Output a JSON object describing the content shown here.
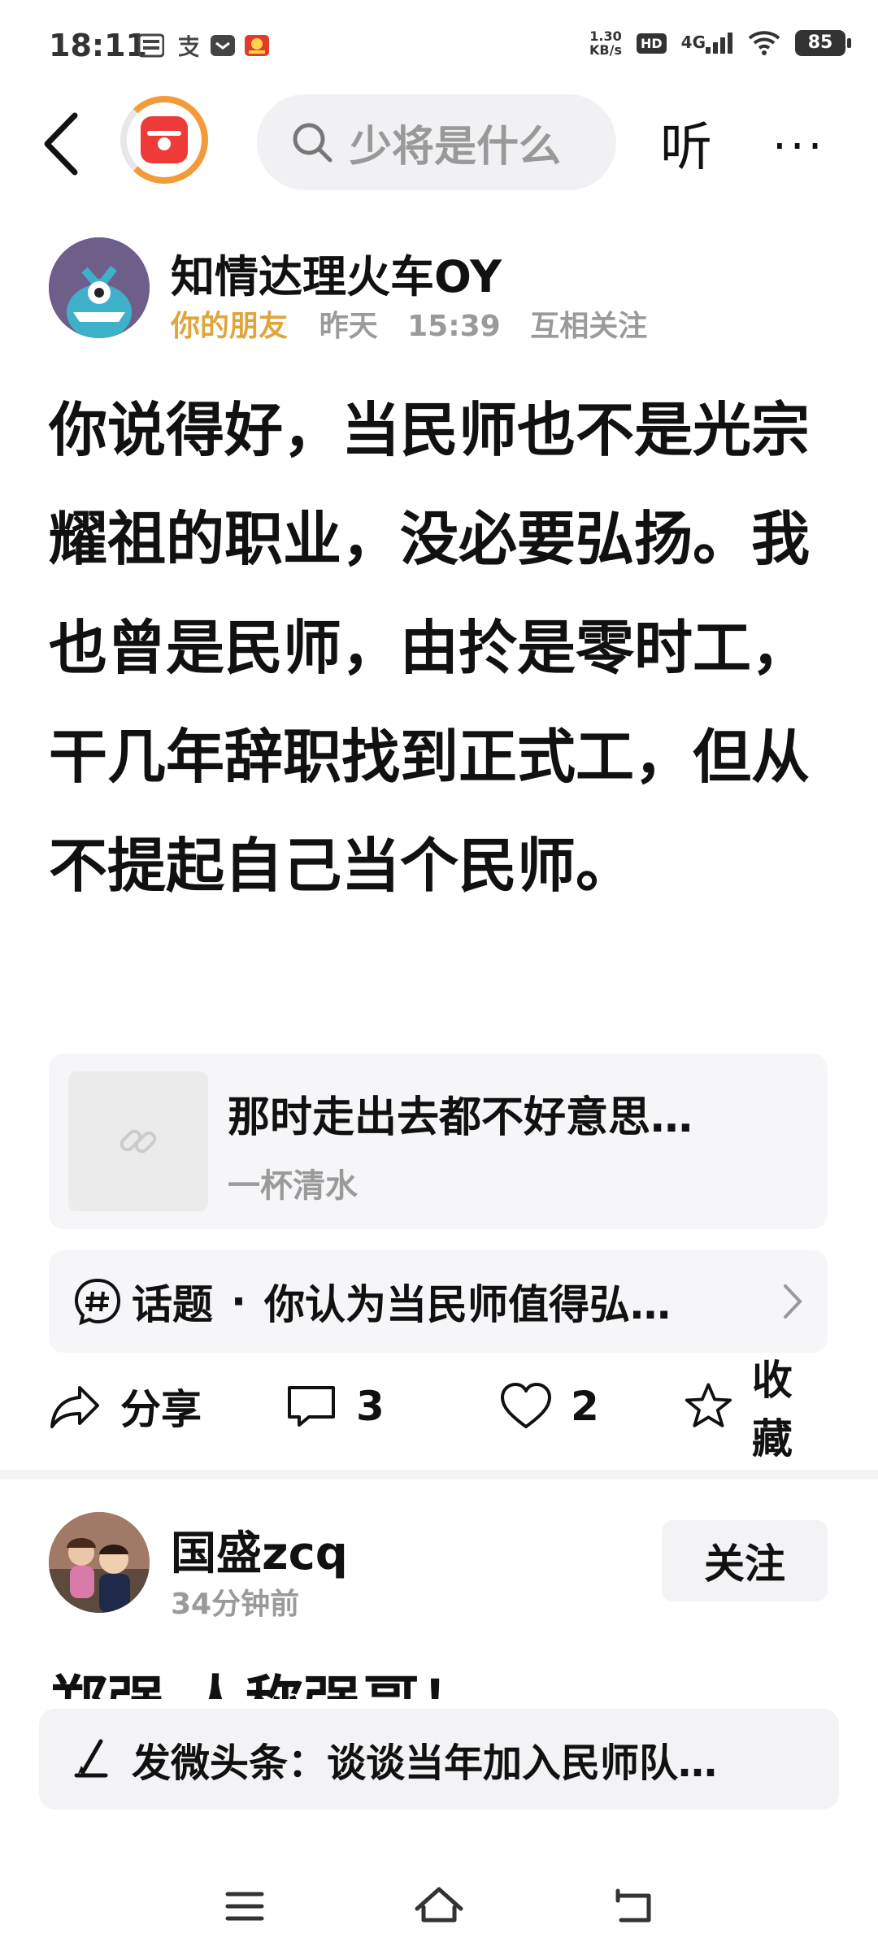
{
  "status_bar": {
    "time": "18:11",
    "net_speed": "1.30",
    "net_unit": "KB/s",
    "hd": "HD",
    "signal": "4G",
    "battery": "85"
  },
  "topnav": {
    "search_placeholder": "少将是什么",
    "listen_label": "听",
    "more_label": "···"
  },
  "post": {
    "author_name": "知情达理火车OY",
    "friend_tag": "你的朋友",
    "date": "昨天",
    "time": "15:39",
    "relation": "互相关注",
    "body": "你说得好，当民师也不是光宗耀祖的职业，没必要弘扬。我也曾是民师，由扵是零时工，干几年辞职找到正式工，但从不提起自己当个民师。",
    "link_card": {
      "title": "那时走出去都不好意思…",
      "source": "一杯清水"
    },
    "topic": {
      "label": "话题",
      "dot": "·",
      "text": "你认为当民师值得弘…"
    },
    "actions": {
      "share_label": "分享",
      "comment_count": "3",
      "like_count": "2",
      "favorite_label": "收藏"
    }
  },
  "comment": {
    "name": "国盛zcq",
    "time": "34分钟前",
    "follow_label": "关注",
    "clipped_text": "郑强  人称强哥！"
  },
  "compose": {
    "text": "发微头条：谈谈当年加入民师队…"
  },
  "colors": {
    "friend_tag": "#e0a53a",
    "accent_ring": "#f39a3a",
    "logo_red": "#ef3a3a"
  }
}
